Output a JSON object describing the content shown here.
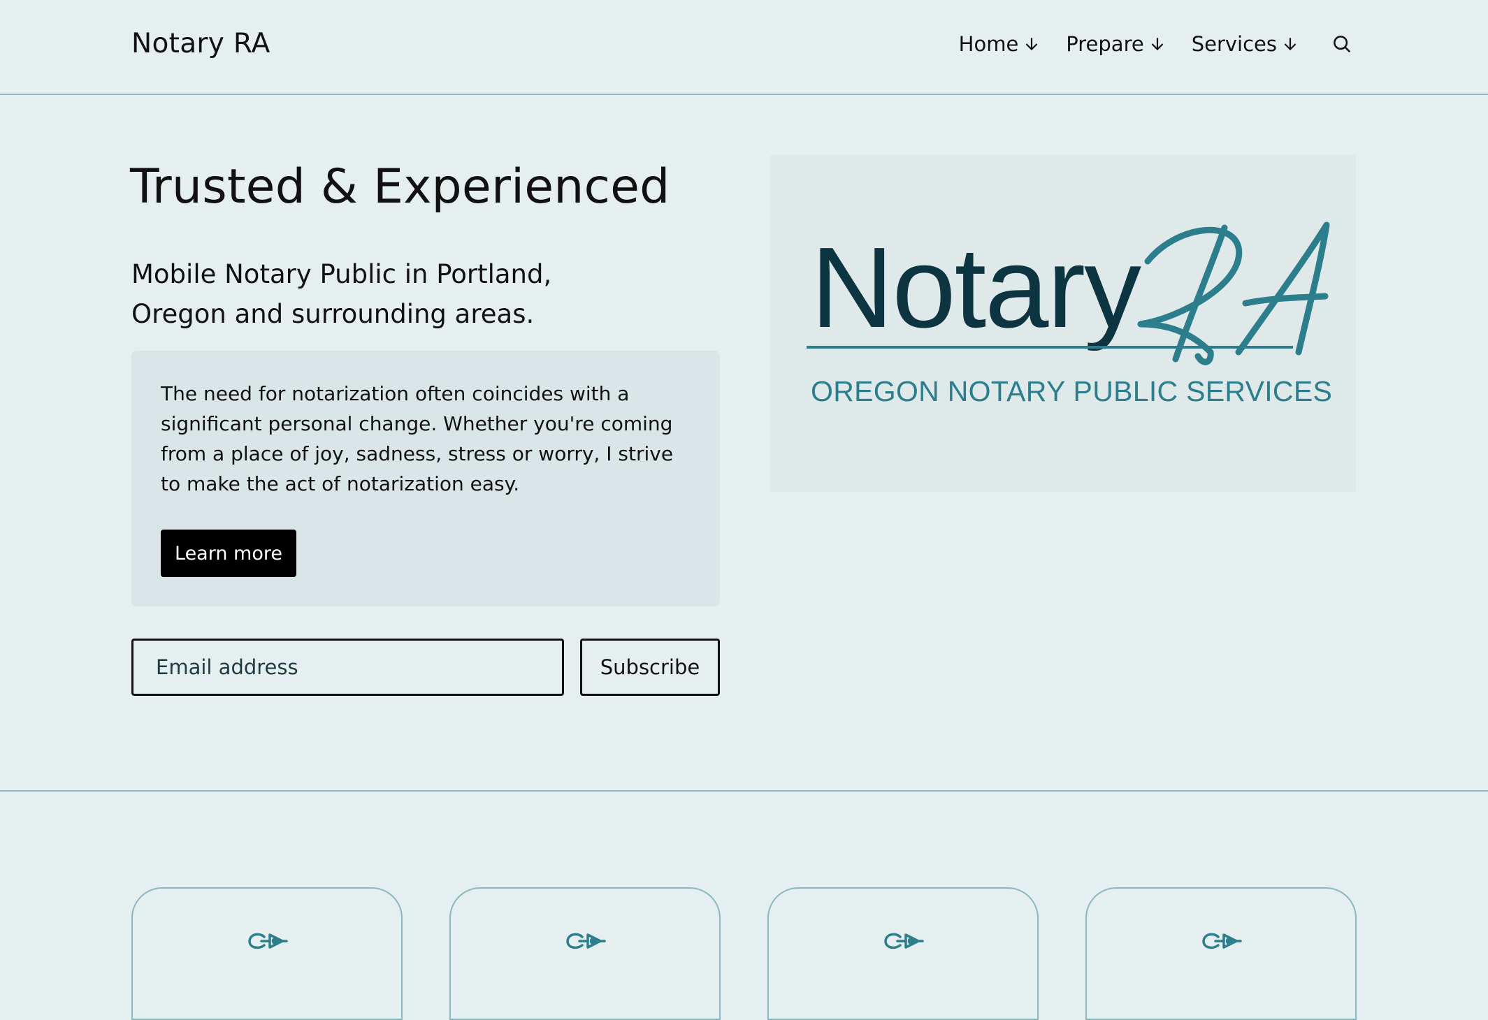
{
  "header": {
    "site_title": "Notary RA",
    "nav": [
      {
        "label": "Home"
      },
      {
        "label": "Prepare"
      },
      {
        "label": "Services"
      }
    ]
  },
  "hero": {
    "heading": "Trusted & Experienced",
    "subheading": "Mobile Notary Public in Portland, Oregon and surrounding areas.",
    "body": "The need for notarization often coincides with a significant personal change. Whether you're coming from a place of joy, sadness, stress or worry, I strive to make the act of notarization easy.",
    "learn_more_label": "Learn more"
  },
  "subscribe": {
    "email_placeholder": "Email address",
    "button_label": "Subscribe"
  },
  "logo": {
    "word": "Notary",
    "script": "RA",
    "tagline": "OREGON NOTARY PUBLIC SERVICES",
    "colors": {
      "dark": "#0d3441",
      "accent": "#2c7e8c"
    }
  },
  "cards": [
    {
      "icon": "pen-nib-icon"
    },
    {
      "icon": "pen-nib-icon"
    },
    {
      "icon": "pen-nib-icon"
    },
    {
      "icon": "pen-nib-icon"
    }
  ],
  "colors": {
    "background": "#e5eff0",
    "panel": "#d9e5e6",
    "divider": "#8cb8bd",
    "button": "#000000"
  }
}
